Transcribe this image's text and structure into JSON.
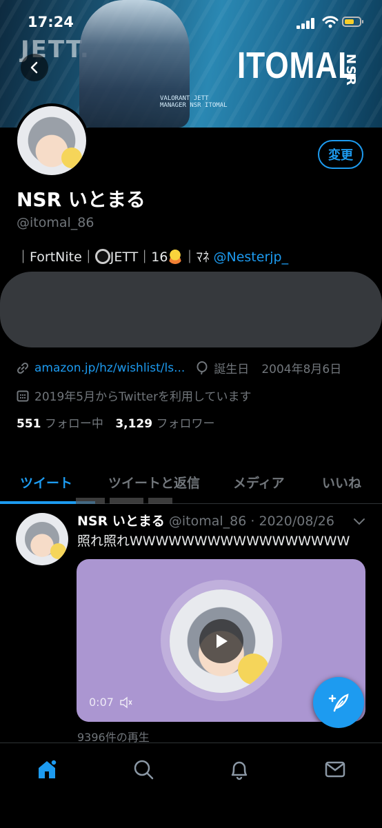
{
  "status_bar": {
    "time": "17:24"
  },
  "banner": {
    "title": "ITOMAL",
    "tag": "NSR",
    "left_text": "JETT.",
    "subtext": [
      "VALORANT JETT",
      "MANAGER NSR ITOMAL"
    ]
  },
  "profile": {
    "edit_label": "変更",
    "display_name": "NSR いとまる",
    "handle": "@itomal_86",
    "bio_prefix": "｜FortNite｜",
    "bio_middle": "JETT｜16",
    "bio_suffix": "｜ﾏﾈ ",
    "bio_mention": "@Nesterjp_",
    "link": "amazon.jp/hz/wishlist/ls...",
    "birthday_label": "誕生日",
    "birthday": "2004年8月6日",
    "joined": "2019年5月からTwitterを利用しています",
    "following_count": "551",
    "following_label": "フォロー中",
    "followers_count": "3,129",
    "followers_label": "フォロワー"
  },
  "tabs": [
    {
      "label": "ツイート",
      "active": true
    },
    {
      "label": "ツイートと返信",
      "active": false
    },
    {
      "label": "メディア",
      "active": false
    },
    {
      "label": "いいね",
      "active": false
    }
  ],
  "tweet": {
    "name": "NSR いとまる",
    "meta": "@itomal_86 · 2020/08/26",
    "text": "照れ照れWWWWWWWWWWWWWWWWW",
    "duration": "0:07",
    "views": "9396件の再生"
  },
  "icons": {
    "back": "chevron-left-icon",
    "link": "link-icon",
    "birthday": "balloon-icon",
    "calendar": "calendar-icon",
    "play": "play-icon",
    "volume": "volume-muted-icon",
    "compose": "compose-feather-icon",
    "home": "home-icon",
    "search": "search-icon",
    "notifications": "bell-icon",
    "messages": "mail-icon"
  },
  "colors": {
    "accent": "#1d9bf0",
    "background": "#000000",
    "secondary_text": "#71767b",
    "media_bg": "#ab96d1"
  }
}
